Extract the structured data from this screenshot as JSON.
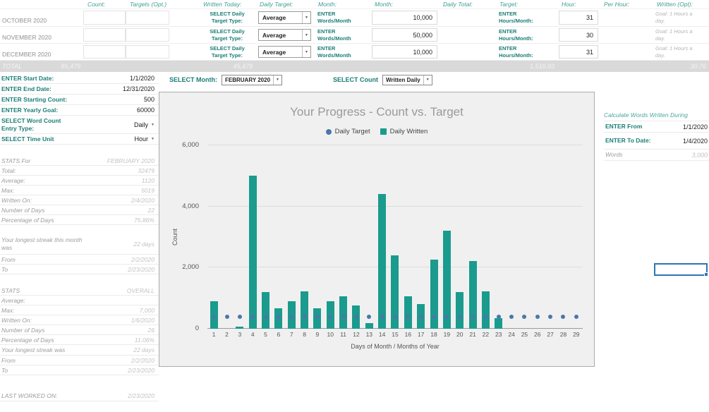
{
  "colors": {
    "teal_label": "#1b7e77",
    "teal_header": "#3f9e94",
    "bar_fill": "#1a9b8e",
    "dot_fill": "#4a77a8",
    "selection_blue": "#2e75b6",
    "total_row_bg": "#d9d9d9"
  },
  "table": {
    "headers": [
      "Count:",
      "Targets (Opt.)",
      "Written Today:",
      "Daily Target:",
      "Month:",
      "Month:",
      "Daily Total:",
      "Target:",
      "Hour:",
      "Per Hour:",
      "Written (Opt):"
    ],
    "rows": [
      {
        "month": "OCTOBER 2020",
        "select1": "SELECT Daily",
        "select2": "Target Type:",
        "dropdown": "Average",
        "w1": "ENTER",
        "w2": "Words/Month",
        "words": "10,000",
        "h1": "ENTER",
        "h2": "Hours/Month:",
        "hours": "31",
        "goal1": "Goal: 1 Hours a",
        "goal2": "day."
      },
      {
        "month": "NOVEMBER 2020",
        "select1": "SELECT Daily",
        "select2": "Target Type:",
        "dropdown": "Average",
        "w1": "ENTER",
        "w2": "Words/Month",
        "words": "50,000",
        "h1": "ENTER",
        "h2": "Hours/Month:",
        "hours": "30",
        "goal1": "Goal: 1 Hours a",
        "goal2": "day."
      },
      {
        "month": "DECEMBER 2020",
        "select1": "SELECT Daily",
        "select2": "Target Type:",
        "dropdown": "Average",
        "w1": "ENTER",
        "w2": "Words/Month",
        "words": "10,000",
        "h1": "ENTER",
        "h2": "Hours/Month:",
        "hours": "31",
        "goal1": "Goal: 1 Hours a",
        "goal2": "day."
      }
    ],
    "total": {
      "label": "TOTAL",
      "count": "85,479",
      "written": "45,479",
      "target": "1,510.93",
      "per_hour": "30.76"
    }
  },
  "left": {
    "fields": [
      {
        "label": "ENTER Start Date:",
        "value": "1/1/2020"
      },
      {
        "label": "ENTER End Date:",
        "value": "12/31/2020"
      },
      {
        "label": "ENTER Starting Count:",
        "value": "500"
      },
      {
        "label": "ENTER Yearly Goal:",
        "value": "60000"
      },
      {
        "label": "SELECT Word Count Entry Type:",
        "value": "Daily"
      },
      {
        "label": "SELECT Time Unit",
        "value": "Hour"
      }
    ],
    "stats_month": {
      "header": "STATS For",
      "period": "FEBRUARY 2020",
      "rows": [
        [
          "Total:",
          "32479"
        ],
        [
          "Average:",
          "1120"
        ],
        [
          "Max:",
          "5019"
        ],
        [
          "Written On:",
          "2/4/2020"
        ],
        [
          "Number of Days",
          "22"
        ],
        [
          "Percentage of Days",
          "75.86%"
        ]
      ],
      "streak_label": "Your longest streak this month was",
      "streak_value": "22 days",
      "from_label": "From",
      "from_value": "2/2/2020",
      "to_label": "To",
      "to_value": "2/23/2020"
    },
    "stats_overall": {
      "header": "STATS",
      "period": "OVERALL",
      "rows": [
        [
          "Average:",
          ""
        ],
        [
          "Max:",
          "7,000"
        ],
        [
          "Written On:",
          "1/6/2020"
        ],
        [
          "Number of Days",
          "26"
        ],
        [
          "Percentage of Days",
          "11.06%"
        ]
      ],
      "streak_label": "Your longest streak was",
      "streak_value": "22 days",
      "from_label": "From",
      "from_value": "2/2/2020",
      "to_label": "To",
      "to_value": "2/23/2020"
    },
    "last_worked": {
      "label": "LAST WORKED ON:",
      "value": "2/23/2020"
    }
  },
  "controls": {
    "month_label": "SELECT Month:",
    "month_value": "FEBRUARY 2020",
    "count_label": "SELECT Count",
    "count_value": "Written Daily"
  },
  "chart_data": {
    "type": "bar",
    "title": "Your Progress - Count vs. Target",
    "xlabel": "Days of Month / Months of Year",
    "ylabel": "Count",
    "ylim": [
      0,
      6000
    ],
    "yticks": [
      0,
      2000,
      4000,
      6000
    ],
    "ytick_labels": [
      "0",
      "2,000",
      "4,000",
      "6,000"
    ],
    "grid": true,
    "legend_position": "top",
    "categories": [
      1,
      2,
      3,
      4,
      5,
      6,
      7,
      8,
      9,
      10,
      11,
      12,
      13,
      14,
      15,
      16,
      17,
      18,
      19,
      20,
      21,
      22,
      23,
      24,
      25,
      26,
      27,
      28,
      29
    ],
    "series": [
      {
        "name": "Daily Target",
        "type": "scatter",
        "color": "#4a77a8",
        "values": [
          400,
          400,
          400,
          400,
          400,
          400,
          400,
          400,
          400,
          400,
          400,
          400,
          400,
          400,
          400,
          400,
          400,
          400,
          400,
          400,
          400,
          400,
          400,
          400,
          400,
          400,
          400,
          400,
          400
        ]
      },
      {
        "name": "Daily Written",
        "type": "bar",
        "color": "#1a9b8e",
        "values": [
          900,
          0,
          70,
          5019,
          1190,
          670,
          900,
          1230,
          670,
          900,
          1070,
          770,
          190,
          4400,
          2400,
          1070,
          810,
          2260,
          3200,
          1190,
          2210,
          1230,
          350,
          0,
          0,
          0,
          0,
          0,
          0
        ]
      }
    ]
  },
  "right": {
    "header": "Calculate Words Written During",
    "rows": [
      {
        "label": "ENTER From",
        "value": "1/1/2020"
      },
      {
        "label": "ENTER To Date:",
        "value": "1/4/2020"
      },
      {
        "label": "Words",
        "value": "3,000"
      }
    ]
  }
}
